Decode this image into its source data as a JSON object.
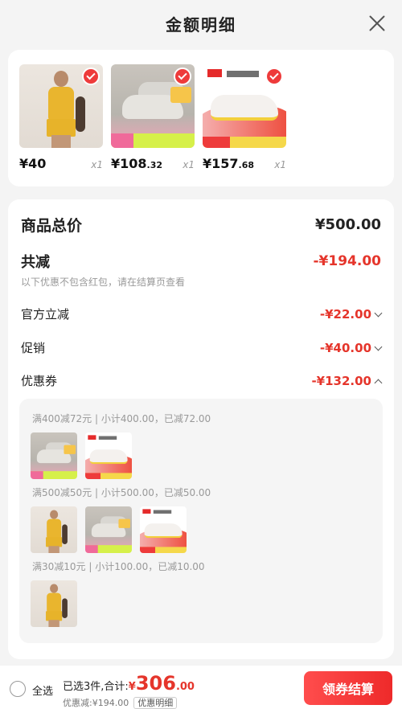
{
  "header": {
    "title": "金额明细"
  },
  "products": [
    {
      "price": "¥40",
      "cents": "",
      "qty": "x1"
    },
    {
      "price": "¥108",
      "cents": ".32",
      "qty": "x1"
    },
    {
      "price": "¥157",
      "cents": ".68",
      "qty": "x1"
    }
  ],
  "detail": {
    "total_label": "商品总价",
    "total_value": "¥500.00",
    "reduce_label": "共减",
    "reduce_value": "-¥194.00",
    "reduce_note": "以下优惠不包含红包，请在结算页查看",
    "official_label": "官方立减",
    "official_value": "-¥22.00",
    "promo_label": "促销",
    "promo_value": "-¥40.00",
    "coupon_label": "优惠券",
    "coupon_value": "-¥132.00",
    "coupon_groups": [
      {
        "title": "满400减72元 | 小计400.00，已减72.00"
      },
      {
        "title": "满500减50元 | 小计500.00，已减50.00"
      },
      {
        "title": "满30减10元 | 小计100.00，已减10.00"
      }
    ]
  },
  "footer": {
    "select_all": "全选",
    "summary_prefix": "已选3件,合计:",
    "currency": "¥",
    "total_int": "306",
    "total_cents": ".00",
    "saved": "优惠减:¥194.00",
    "detail_link": "优惠明细",
    "checkout": "领券结算"
  },
  "colors": {
    "accent": "#e5352b",
    "check": "#ee3b3b"
  }
}
